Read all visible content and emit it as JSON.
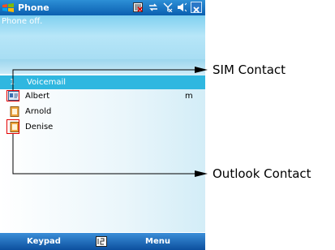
{
  "window": {
    "title": "Phone"
  },
  "status_text": "Phone off.",
  "list": {
    "voicemail": {
      "number": "1",
      "label": "Voicemail"
    },
    "contacts": [
      {
        "name": "Albert",
        "type": "m",
        "source": "sim"
      },
      {
        "name": "Arnold",
        "type": "",
        "source": "outlook"
      },
      {
        "name": "Denise",
        "type": "",
        "source": "outlook"
      }
    ]
  },
  "softkeys": {
    "left": "Keypad",
    "right": "Menu"
  },
  "annotations": {
    "sim": "SIM Contact",
    "outlook": "Outlook Contact"
  },
  "colors": {
    "title_bar": "#0a5fb0",
    "highlight": "#2fb7e0",
    "callout_box": "#e30000"
  }
}
